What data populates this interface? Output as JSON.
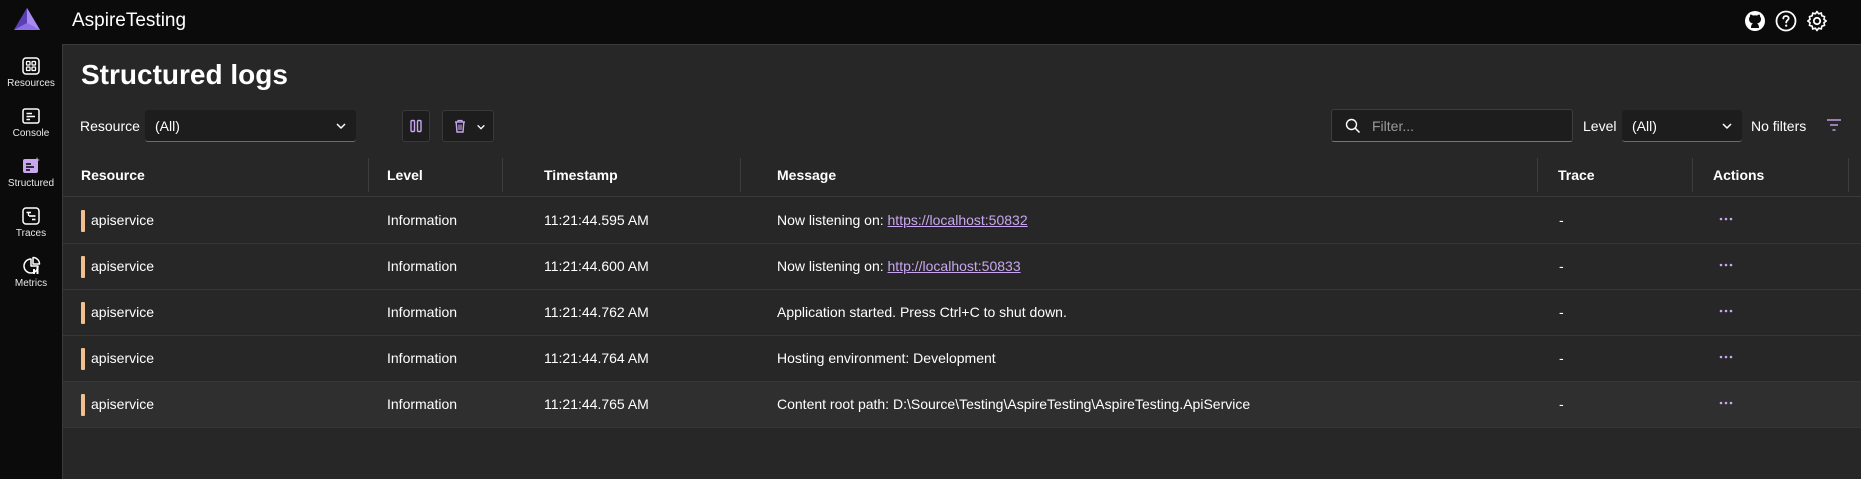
{
  "header": {
    "app_title": "AspireTesting"
  },
  "sidebar": {
    "items": [
      {
        "label": "Resources",
        "icon": "resources-icon"
      },
      {
        "label": "Console",
        "icon": "console-icon"
      },
      {
        "label": "Structured",
        "icon": "structured-icon",
        "active": true
      },
      {
        "label": "Traces",
        "icon": "traces-icon"
      },
      {
        "label": "Metrics",
        "icon": "metrics-icon"
      }
    ]
  },
  "page": {
    "title": "Structured logs"
  },
  "toolbar": {
    "resource_label": "Resource",
    "resource_value": "(All)",
    "filter_placeholder": "Filter...",
    "level_label": "Level",
    "level_value": "(All)",
    "no_filters": "No filters"
  },
  "table": {
    "columns": [
      "Resource",
      "Level",
      "Timestamp",
      "Message",
      "Trace",
      "Actions"
    ],
    "rows": [
      {
        "resource": "apiservice",
        "level": "Information",
        "timestamp": "11:21:44.595 AM",
        "message_prefix": "Now listening on: ",
        "message_link": "https://localhost:50832",
        "trace": "-"
      },
      {
        "resource": "apiservice",
        "level": "Information",
        "timestamp": "11:21:44.600 AM",
        "message_prefix": "Now listening on: ",
        "message_link": "http://localhost:50833",
        "trace": "-"
      },
      {
        "resource": "apiservice",
        "level": "Information",
        "timestamp": "11:21:44.762 AM",
        "message_prefix": "Application started. Press Ctrl+C to shut down.",
        "message_link": "",
        "trace": "-"
      },
      {
        "resource": "apiservice",
        "level": "Information",
        "timestamp": "11:21:44.764 AM",
        "message_prefix": "Hosting environment: Development",
        "message_link": "",
        "trace": "-"
      },
      {
        "resource": "apiservice",
        "level": "Information",
        "timestamp": "11:21:44.765 AM",
        "message_prefix": "Content root path: D:\\Source\\Testing\\AspireTesting\\AspireTesting.ApiService",
        "message_link": "",
        "trace": "-"
      }
    ]
  },
  "colors": {
    "accent": "#c9a6f0",
    "resource_bar": "#f2c08f",
    "background": "#272727"
  }
}
